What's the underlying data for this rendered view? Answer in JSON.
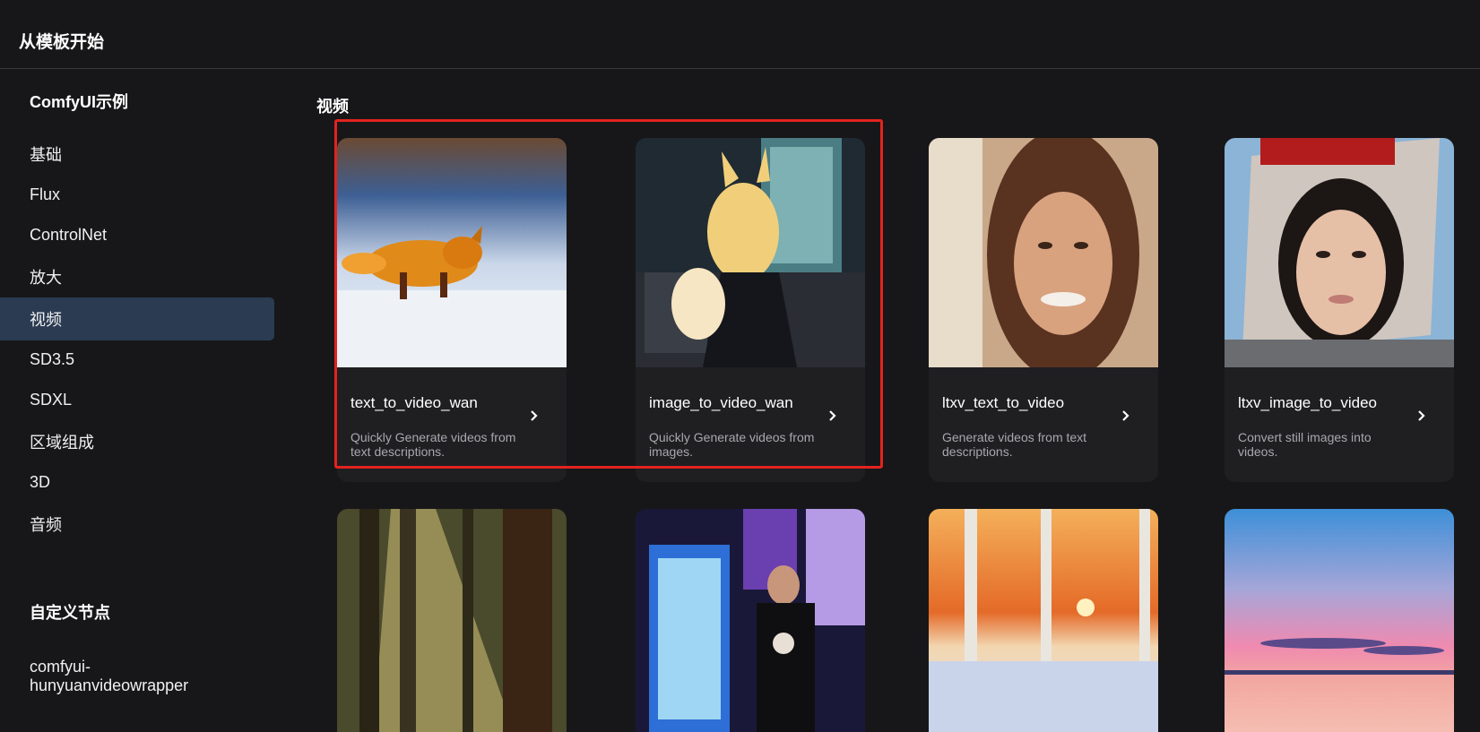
{
  "header": {
    "title": "从模板开始"
  },
  "sidebar": {
    "group1_heading": "ComfyUI示例",
    "items": [
      {
        "label": "基础"
      },
      {
        "label": "Flux"
      },
      {
        "label": "ControlNet"
      },
      {
        "label": "放大"
      },
      {
        "label": "视频",
        "active": true
      },
      {
        "label": "SD3.5"
      },
      {
        "label": "SDXL"
      },
      {
        "label": "区域组成"
      },
      {
        "label": "3D"
      },
      {
        "label": "音频"
      }
    ],
    "group2_heading": "自定义节点",
    "custom_items": [
      {
        "label_line1": "comfyui-",
        "label_line2": "hunyuanvideowrapper"
      }
    ]
  },
  "main": {
    "section_title": "视频",
    "cards": [
      {
        "name": "text_to_video_wan",
        "description": "Quickly Generate videos from text descriptions.",
        "thumbnail": "fox-running-in-snow"
      },
      {
        "name": "image_to_video_wan",
        "description": "Quickly Generate videos from images.",
        "thumbnail": "fox-girl-in-gothic-kitchen"
      },
      {
        "name": "ltxv_text_to_video",
        "description": "Generate videos from text descriptions.",
        "thumbnail": "smiling-woman-portrait"
      },
      {
        "name": "ltxv_image_to_video",
        "description": "Convert still images into videos.",
        "thumbnail": "woman-face-on-billboard"
      },
      {
        "thumbnail": "sunlit-forest"
      },
      {
        "thumbnail": "man-at-vending-machines-night"
      },
      {
        "thumbnail": "winter-birch-sunset"
      },
      {
        "thumbnail": "pink-sunset-lake"
      }
    ]
  },
  "colors": {
    "background": "#171719",
    "card_background": "#1f1f22",
    "active_item": "#2b3b52",
    "highlight_border": "#e3231f"
  }
}
